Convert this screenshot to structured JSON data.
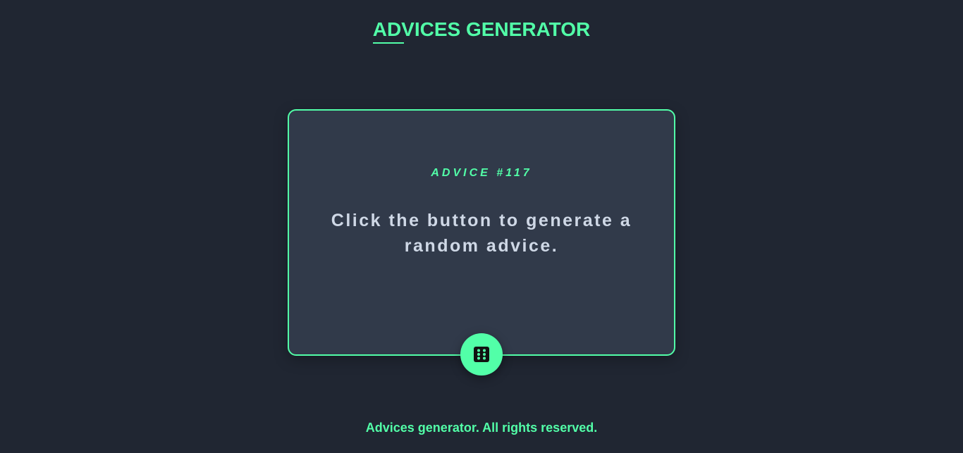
{
  "header": {
    "title": "ADVICES GENERATOR"
  },
  "card": {
    "advice_id": "ADVICE #117",
    "advice_text": "Click the button to generate a random advice.",
    "dice_icon": "dice-icon"
  },
  "footer": {
    "text": "Advices generator. All rights reserved."
  },
  "colors": {
    "background": "#202632",
    "card": "#313a4a",
    "accent": "#52ffa8",
    "text": "#cfd8e6"
  }
}
